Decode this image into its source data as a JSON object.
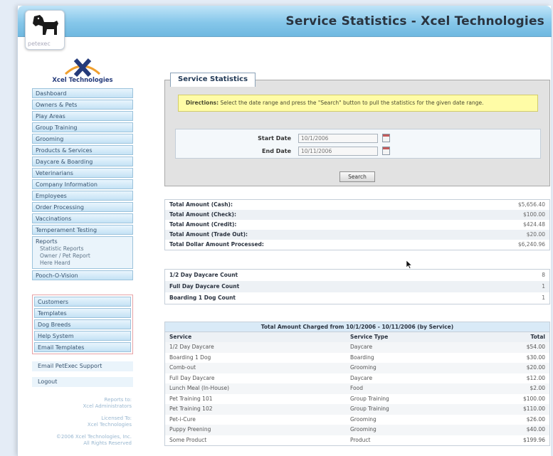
{
  "header": {
    "title": "Service Statistics - Xcel Technologies",
    "logo_sub": "petexec"
  },
  "sidebar": {
    "brand": "Xcel Technologies",
    "items": [
      "Dashboard",
      "Owners & Pets",
      "Play Areas",
      "Group Training",
      "Grooming",
      "Products & Services",
      "Daycare & Boarding",
      "Veterinarians",
      "Company Information",
      "Employees",
      "Order Processing",
      "Vaccinations",
      "Temperament Testing"
    ],
    "reports": {
      "title": "Reports",
      "subitems": [
        "Statistic Reports",
        "Owner / Pet Report",
        "Here Heard"
      ]
    },
    "after_reports": "Pooch-O-Vision",
    "admin_items": [
      "Customers",
      "Templates",
      "Dog Breeds",
      "Help System",
      "Email Templates"
    ],
    "email_support": "Email PetExec Support",
    "logout": "Logout",
    "footer": {
      "reports_to_1": "Reports to:",
      "reports_to_2": "Xcel Administrators",
      "licensed_1": "Licensed To:",
      "licensed_2": "Xcel Technologies",
      "copy_1": "©2006 Xcel Technologies, Inc.",
      "copy_2": "All Rights Reserved"
    }
  },
  "stats": {
    "tab_label": "Service Statistics",
    "directions_label": "Directions:",
    "directions_text": "Select the date range and press the \"Search\" button to pull the statistics for the given date range.",
    "start_label": "Start Date",
    "start_value": "10/1/2006",
    "end_label": "End Date",
    "end_value": "10/11/2006",
    "search_label": "Search"
  },
  "amounts": [
    {
      "label": "Total Amount (Cash):",
      "value": "$5,656.40"
    },
    {
      "label": "Total Amount (Check):",
      "value": "$100.00"
    },
    {
      "label": "Total Amount (Credit):",
      "value": "$424.48"
    },
    {
      "label": "Total Amount (Trade Out):",
      "value": "$20.00"
    },
    {
      "label": "Total Dollar Amount Processed:",
      "value": "$6,240.96"
    }
  ],
  "counts": [
    {
      "label": "1/2 Day Daycare Count",
      "value": "8"
    },
    {
      "label": "Full Day Daycare Count",
      "value": "1"
    },
    {
      "label": "Boarding 1 Dog Count",
      "value": "1"
    }
  ],
  "charges": {
    "title": "Total Amount Charged from 10/1/2006 - 10/11/2006 (by Service)",
    "columns": {
      "service": "Service",
      "type": "Service Type",
      "total": "Total"
    },
    "rows": [
      {
        "service": "1/2 Day Daycare",
        "type": "Daycare",
        "total": "$54.00"
      },
      {
        "service": "Boarding 1 Dog",
        "type": "Boarding",
        "total": "$30.00"
      },
      {
        "service": "Comb-out",
        "type": "Grooming",
        "total": "$20.00"
      },
      {
        "service": "Full Day Daycare",
        "type": "Daycare",
        "total": "$12.00"
      },
      {
        "service": "Lunch Meal (In-House)",
        "type": "Food",
        "total": "$2.00"
      },
      {
        "service": "Pet Training 101",
        "type": "Group Training",
        "total": "$100.00"
      },
      {
        "service": "Pet Training 102",
        "type": "Group Training",
        "total": "$110.00"
      },
      {
        "service": "Pet-i-Cure",
        "type": "Grooming",
        "total": "$26.00"
      },
      {
        "service": "Puppy Preening",
        "type": "Grooming",
        "total": "$40.00"
      },
      {
        "service": "Some Product",
        "type": "Product",
        "total": "$199.96"
      }
    ]
  },
  "colors": {
    "header_blue": "#86c7ea",
    "nav_blue": "#c4e2f5",
    "directions_yellow": "#fffca6",
    "admin_border": "#e7a2a6",
    "brand_navy": "#243a7a",
    "brand_orange": "#f0a030"
  }
}
